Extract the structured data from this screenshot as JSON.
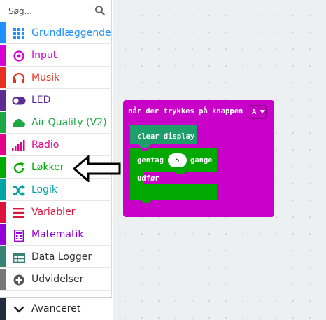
{
  "toolbox": {
    "search_placeholder": "Søg...",
    "categories": [
      {
        "label": "Grundlæggende",
        "color": "#1e90ff",
        "icon": "grid-icon"
      },
      {
        "label": "Input",
        "color": "#d400d4",
        "icon": "target-icon"
      },
      {
        "label": "Musik",
        "color": "#e63022",
        "icon": "headphones-icon"
      },
      {
        "label": "LED",
        "color": "#5c2d91",
        "icon": "toggle-icon"
      },
      {
        "label": "Air Quality (V2)",
        "color": "#1da844",
        "icon": "cloud-icon"
      },
      {
        "label": "Radio",
        "color": "#e3008c",
        "icon": "signal-bars-icon"
      },
      {
        "label": "Løkker",
        "color": "#00aa00",
        "icon": "refresh-icon"
      },
      {
        "label": "Logik",
        "color": "#00a4a6",
        "icon": "shuffle-icon"
      },
      {
        "label": "Variabler",
        "color": "#dc143c",
        "icon": "lines-icon"
      },
      {
        "label": "Matematik",
        "color": "#9400d3",
        "icon": "calculator-icon"
      },
      {
        "label": "Data Logger",
        "color": "#378273",
        "icon": "table-icon"
      },
      {
        "label": "Udvidelser",
        "color": "#777777",
        "icon": "plus-circle-icon"
      }
    ],
    "advanced": {
      "label": "Avanceret",
      "icon": "chevron-down-icon"
    }
  },
  "workspace": {
    "event_block": {
      "text": "når der trykkes på knappen",
      "button_value": "A",
      "color": "#c800c8"
    },
    "clear_block": {
      "text": "clear display",
      "color": "#1e9e6a"
    },
    "repeat_block": {
      "prefix": "gentag",
      "count": "5",
      "suffix": "gange",
      "do_label": "udfør",
      "color": "#00a800"
    }
  }
}
